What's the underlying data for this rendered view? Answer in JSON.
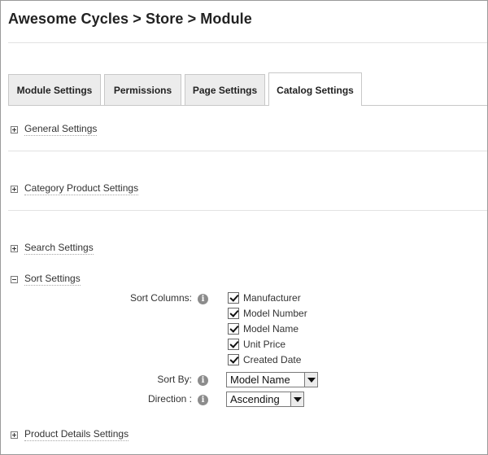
{
  "page": {
    "title": "Awesome Cycles > Store > Module"
  },
  "tabs": [
    {
      "label": "Module Settings",
      "active": false
    },
    {
      "label": "Permissions",
      "active": false
    },
    {
      "label": "Page Settings",
      "active": false
    },
    {
      "label": "Catalog Settings",
      "active": true
    }
  ],
  "sections": {
    "general": {
      "label": "General Settings",
      "expanded": false
    },
    "category_product": {
      "label": "Category Product Settings",
      "expanded": false
    },
    "search": {
      "label": "Search Settings",
      "expanded": false
    },
    "sort": {
      "label": "Sort Settings",
      "expanded": true
    },
    "product_details": {
      "label": "Product Details Settings",
      "expanded": false
    }
  },
  "sort_settings": {
    "sort_columns_label": "Sort Columns:",
    "sort_columns": [
      {
        "label": "Manufacturer",
        "checked": true
      },
      {
        "label": "Model Number",
        "checked": true
      },
      {
        "label": "Model Name",
        "checked": true
      },
      {
        "label": "Unit Price",
        "checked": true
      },
      {
        "label": "Created Date",
        "checked": true
      }
    ],
    "sort_by_label": "Sort By:",
    "sort_by_value": "Model Name",
    "direction_label": "Direction :",
    "direction_value": "Ascending"
  },
  "icons": {
    "info": "info-icon",
    "expand": "plus-box-icon",
    "collapse": "minus-box-icon"
  },
  "colors": {
    "title_text": "#222222",
    "tab_inactive_bg": "#ececec",
    "tab_border": "#c8c8c8",
    "info_icon_bg": "#8c8c8c",
    "divider": "#e2e2e2"
  }
}
